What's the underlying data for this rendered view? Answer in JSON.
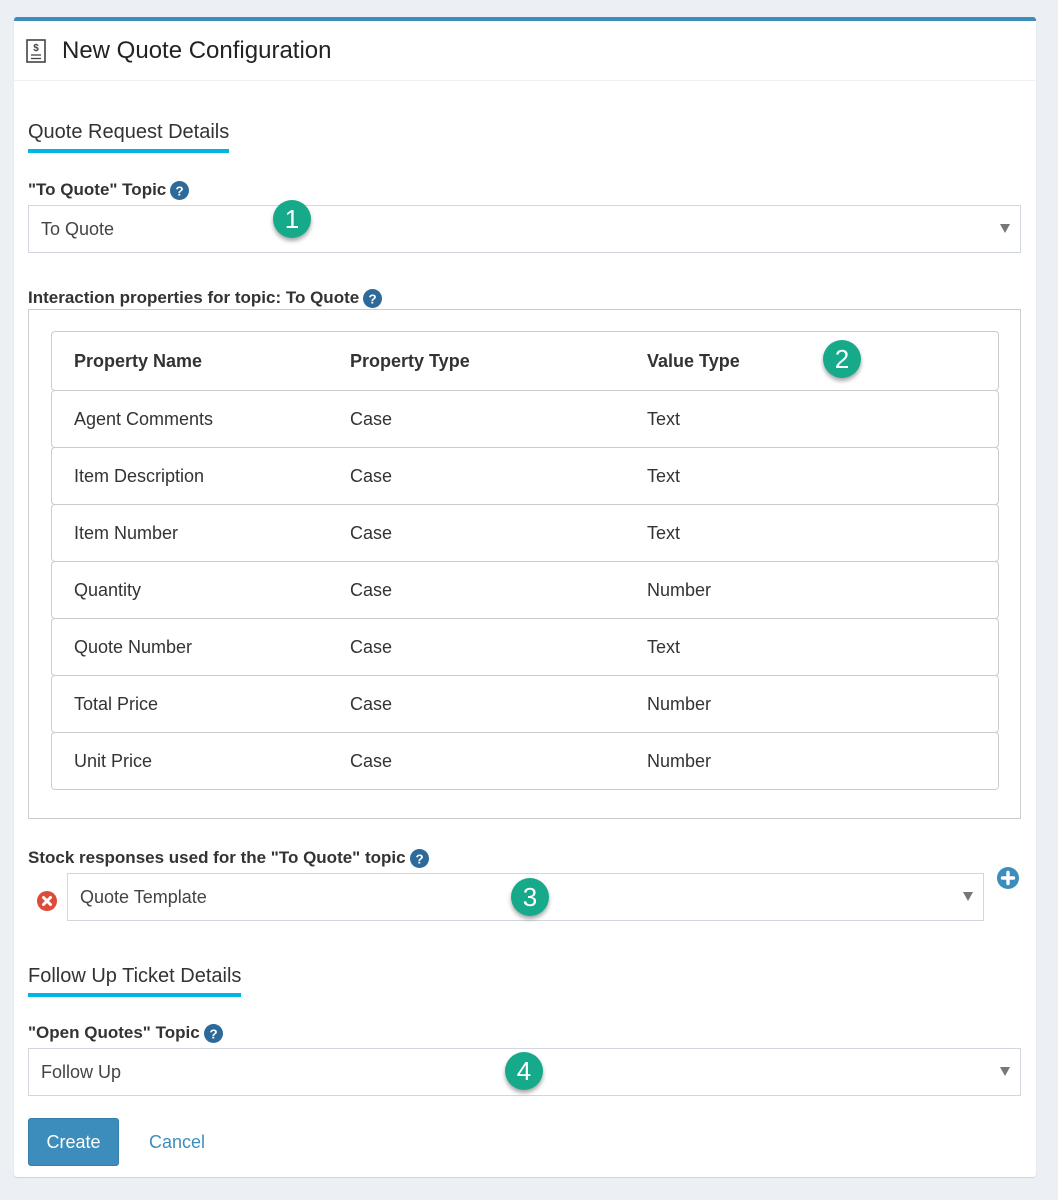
{
  "header": {
    "title": "New Quote Configuration",
    "icon": "quote-document-icon"
  },
  "quote_request": {
    "section_title": "Quote Request Details",
    "topic_label": "\"To Quote\" Topic",
    "topic_value": "To Quote",
    "props_label": "Interaction properties for topic: To Quote",
    "columns": [
      "Property Name",
      "Property Type",
      "Value Type"
    ],
    "rows": [
      [
        "Agent Comments",
        "Case",
        "Text"
      ],
      [
        "Item Description",
        "Case",
        "Text"
      ],
      [
        "Item Number",
        "Case",
        "Text"
      ],
      [
        "Quantity",
        "Case",
        "Number"
      ],
      [
        "Quote Number",
        "Case",
        "Text"
      ],
      [
        "Total Price",
        "Case",
        "Number"
      ],
      [
        "Unit Price",
        "Case",
        "Number"
      ]
    ],
    "stock_label": "Stock responses used for the \"To Quote\" topic",
    "stock_value": "Quote Template"
  },
  "follow_up": {
    "section_title": "Follow Up Ticket Details",
    "topic_label": "\"Open Quotes\" Topic",
    "topic_value": "Follow Up"
  },
  "callouts": [
    "1",
    "2",
    "3",
    "4"
  ],
  "actions": {
    "create": "Create",
    "cancel": "Cancel"
  },
  "colors": {
    "primary": "#3c8dbc",
    "accent_underline": "#00b5e2",
    "callout": "#16a98a",
    "danger": "#dd4b39"
  }
}
